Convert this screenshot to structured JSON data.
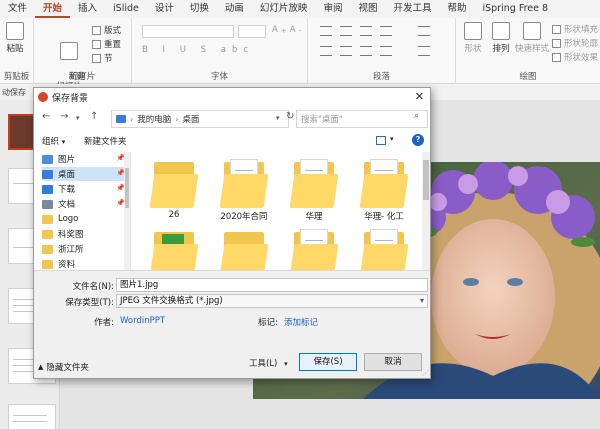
{
  "ribbon": {
    "tabs": [
      "文件",
      "开始",
      "插入",
      "iSlide",
      "设计",
      "切换",
      "动画",
      "幻灯片放映",
      "审阅",
      "视图",
      "开发工具",
      "帮助",
      "iSpring Free 8"
    ],
    "active_tab": "开始",
    "groups": {
      "clipboard": {
        "paste_label": "粘贴",
        "label": "剪贴板"
      },
      "slides": {
        "new_slide_label": "新建\n幻灯片",
        "layout_label": "版式",
        "reset_label": "重置",
        "section_label": "节",
        "label": "幻灯片"
      },
      "font": {
        "label": "字体"
      },
      "paragraph": {
        "label": "段落"
      },
      "drawing": {
        "shape_label": "形状",
        "arrange_label": "排列",
        "quick_styles_label": "快速样式",
        "fill_label": "形状填充",
        "outline_label": "形状轮廓",
        "effect_label": "形状效果",
        "label": "绘图"
      }
    },
    "qat_text": "动保存"
  },
  "dialog": {
    "title": "保存背景",
    "breadcrumb": [
      "我的电脑",
      "桌面"
    ],
    "search_placeholder": "搜索\"桌面\"",
    "organize_label": "组织",
    "new_folder_label": "新建文件夹",
    "nav_items": [
      {
        "label": "图片",
        "color": "#4a90d9",
        "pinned": true
      },
      {
        "label": "桌面",
        "color": "#3d7bd8",
        "pinned": true,
        "selected": true
      },
      {
        "label": "下载",
        "color": "#2f7fd0",
        "pinned": true
      },
      {
        "label": "文档",
        "color": "#7b8a9a",
        "pinned": true
      },
      {
        "label": "Logo",
        "color": "#f0c64f",
        "pinned": false
      },
      {
        "label": "科奖图",
        "color": "#f0c64f",
        "pinned": false
      },
      {
        "label": "浙江所",
        "color": "#f0c64f",
        "pinned": false
      },
      {
        "label": "资料",
        "color": "#f0c64f",
        "pinned": false
      }
    ],
    "files": [
      {
        "label": "26",
        "kind": "folder"
      },
      {
        "label": "2020年合同",
        "kind": "folder-doc"
      },
      {
        "label": "华理",
        "kind": "folder-doc"
      },
      {
        "label": "华理- 化工",
        "kind": "folder-doc"
      },
      {
        "label": "",
        "kind": "folder-green"
      },
      {
        "label": "",
        "kind": "folder"
      },
      {
        "label": "",
        "kind": "folder-doc"
      },
      {
        "label": "",
        "kind": "folder-doc"
      }
    ],
    "filename_label": "文件名(N):",
    "filename_value": "图片1.jpg",
    "filetype_label": "保存类型(T):",
    "filetype_value": "JPEG 文件交换格式 (*.jpg)",
    "author_label": "作者:",
    "author_value": "WordinPPT",
    "tags_label": "标记:",
    "tags_value": "添加标记",
    "hide_folders_label": "隐藏文件夹",
    "tools_label": "工具(L)",
    "save_label": "保存(S)",
    "cancel_label": "取消"
  },
  "colors": {
    "accent": "#b7472a",
    "selection": "#cde3f7",
    "link": "#1f5fbf",
    "folder": "#ffd867"
  }
}
